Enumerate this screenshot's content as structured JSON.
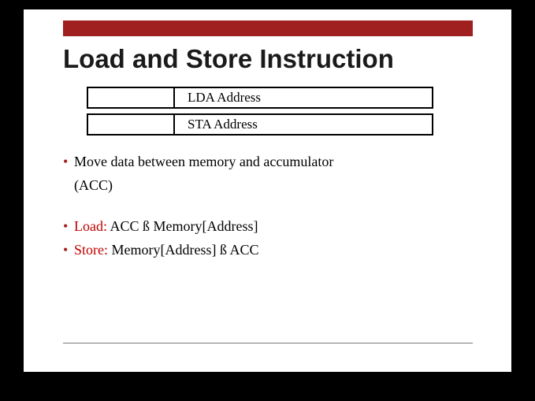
{
  "title": "Load and Store Instruction",
  "table": {
    "row1": "LDA  Address",
    "row2": "STA   Address"
  },
  "bullets": {
    "b1_line1": "Move data between memory and accumulator",
    "b1_line2": "(ACC)",
    "b2_label": "Load:",
    "b2_rest": " ACC ß Memory[Address]",
    "b3_label": "Store:",
    "b3_rest": " Memory[Address] ß ACC"
  },
  "colors": {
    "accent": "#a01f1f",
    "emphasis": "#c00000"
  }
}
